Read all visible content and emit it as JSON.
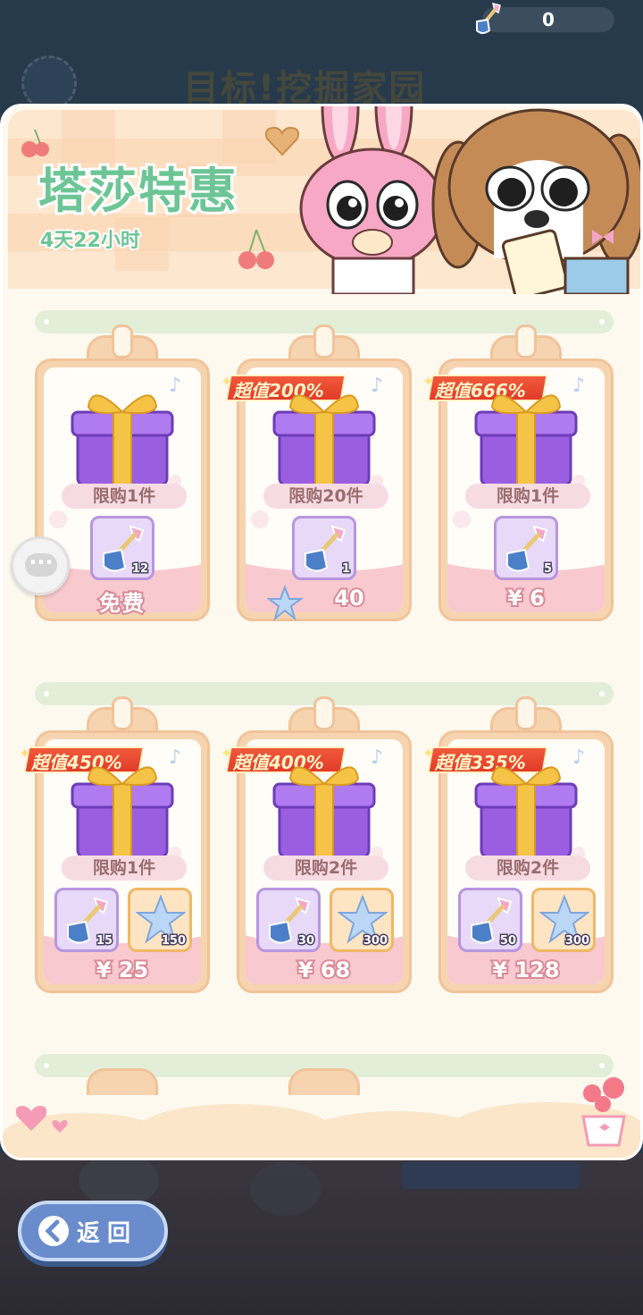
{
  "currency": {
    "shovel_count": "0",
    "icon": "shovel-icon"
  },
  "background": {
    "title": "目标!挖掘家园"
  },
  "banner": {
    "title": "塔莎特惠",
    "timer": "4天22小时"
  },
  "offers": [
    {
      "badge": "",
      "limit": "限购1件",
      "items": [
        {
          "icon": "shovel-icon",
          "qty": "12"
        }
      ],
      "price": "免费",
      "currency_icon": ""
    },
    {
      "badge": "超值200%",
      "limit": "限购20件",
      "items": [
        {
          "icon": "shovel-icon",
          "qty": "1"
        }
      ],
      "price": "40",
      "currency_icon": "crystal-star-icon"
    },
    {
      "badge": "超值666%",
      "limit": "限购1件",
      "items": [
        {
          "icon": "shovel-icon",
          "qty": "5"
        }
      ],
      "price": "¥ 6",
      "currency_icon": ""
    },
    {
      "badge": "超值450%",
      "limit": "限购1件",
      "items": [
        {
          "icon": "shovel-icon",
          "qty": "15"
        },
        {
          "icon": "crystal-star-icon",
          "qty": "150"
        }
      ],
      "price": "¥ 25",
      "currency_icon": ""
    },
    {
      "badge": "超值400%",
      "limit": "限购2件",
      "items": [
        {
          "icon": "shovel-icon",
          "qty": "30"
        },
        {
          "icon": "crystal-star-icon",
          "qty": "300"
        }
      ],
      "price": "¥ 68",
      "currency_icon": ""
    },
    {
      "badge": "超值335%",
      "limit": "限购2件",
      "items": [
        {
          "icon": "shovel-icon",
          "qty": "50"
        },
        {
          "icon": "crystal-star-icon",
          "qty": "300"
        }
      ],
      "price": "¥ 128",
      "currency_icon": ""
    }
  ],
  "back_button": {
    "label": "返回"
  },
  "colors": {
    "accent_green": "#6dc596",
    "badge_red": "#e13b28",
    "price_pink": "#f8c9cf",
    "button_blue": "#6a8ccc"
  }
}
